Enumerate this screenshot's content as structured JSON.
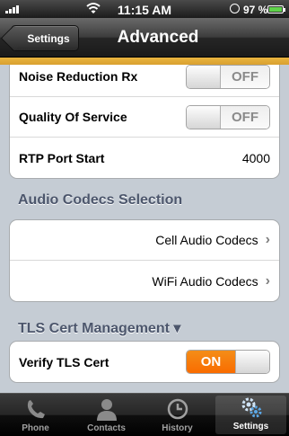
{
  "status_bar": {
    "time": "11:15 AM",
    "battery": "97 %"
  },
  "nav": {
    "back_label": "Settings",
    "title": "Advanced"
  },
  "rows_top": [
    {
      "label": "Noise Reduction Rx",
      "toggle": "OFF"
    },
    {
      "label": "Quality Of Service",
      "toggle": "OFF"
    },
    {
      "label": "RTP Port Start",
      "value": "4000"
    }
  ],
  "audio_codecs": {
    "header": "Audio Codecs Selection",
    "items": [
      "Cell Audio Codecs",
      "WiFi Audio Codecs"
    ]
  },
  "tls": {
    "header": "TLS Cert Management ▾",
    "verify_label": "Verify TLS Cert",
    "verify_toggle": "ON"
  },
  "tabs": [
    {
      "label": "Phone",
      "icon": "phone-icon",
      "active": false
    },
    {
      "label": "Contacts",
      "icon": "contacts-icon",
      "active": false
    },
    {
      "label": "History",
      "icon": "history-icon",
      "active": false
    },
    {
      "label": "Settings",
      "icon": "settings-icon",
      "active": true
    }
  ],
  "colors": {
    "accent": "#f96c00",
    "header_text": "#4c566c",
    "background": "#c5ccd4"
  }
}
